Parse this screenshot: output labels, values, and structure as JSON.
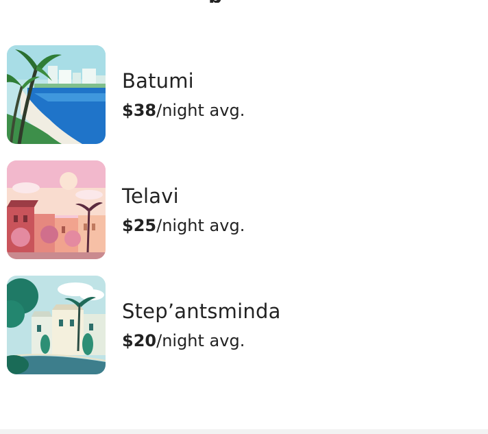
{
  "section": {
    "heading_fragment": "p"
  },
  "destinations": [
    {
      "name": "Batumi",
      "price": "$38",
      "price_suffix": "/night avg.",
      "image_icon": "beach-palm-illustration"
    },
    {
      "name": "Telavi",
      "price": "$25",
      "price_suffix": "/night avg.",
      "image_icon": "pink-town-sunset-illustration"
    },
    {
      "name": "Step’antsminda",
      "price": "$20",
      "price_suffix": "/night avg.",
      "image_icon": "teal-street-illustration"
    }
  ],
  "colors": {
    "text": "#222222",
    "footer_band": "#f2f2f2",
    "background": "#ffffff"
  }
}
